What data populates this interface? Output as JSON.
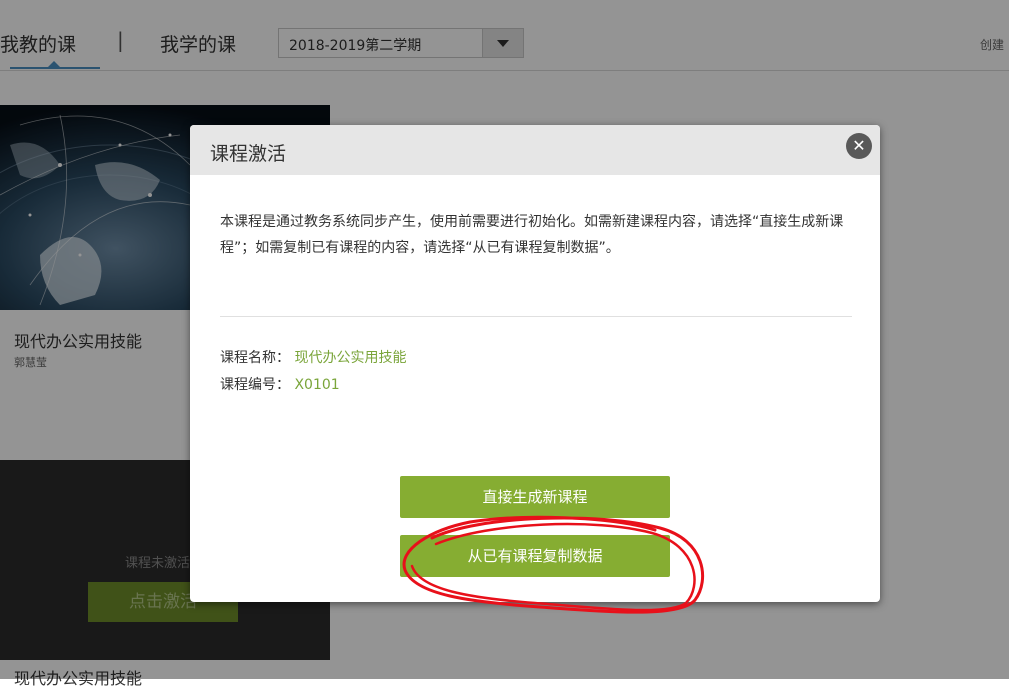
{
  "nav": {
    "tab_teach": "我教的课",
    "divider": "|",
    "tab_learn": "我学的课",
    "semester": "2018-2019第二学期",
    "create_link": "创建"
  },
  "course_card": {
    "name": "现代办公实用技能",
    "teacher": "郭慧莹",
    "inactive_text": "课程未激活",
    "activate_label": "点击激活",
    "bottom_name": "现代办公实用技能"
  },
  "modal": {
    "title": "课程激活",
    "close_symbol": "✕",
    "description": "本课程是通过教务系统同步产生，使用前需要进行初始化。如需新建课程内容，请选择“直接生成新课程”；如需复制已有课程的内容，请选择“从已有课程复制数据”。",
    "course_name_label": "课程名称：",
    "course_name_value": "现代办公实用技能",
    "course_code_label": "课程编号：",
    "course_code_value": "X0101",
    "generate_label": "直接生成新课程",
    "copy_label": "从已有课程复制数据"
  },
  "colors": {
    "accent_green": "#86ad32",
    "link_green": "#7aa53a",
    "annotation_red": "#e8101a"
  }
}
